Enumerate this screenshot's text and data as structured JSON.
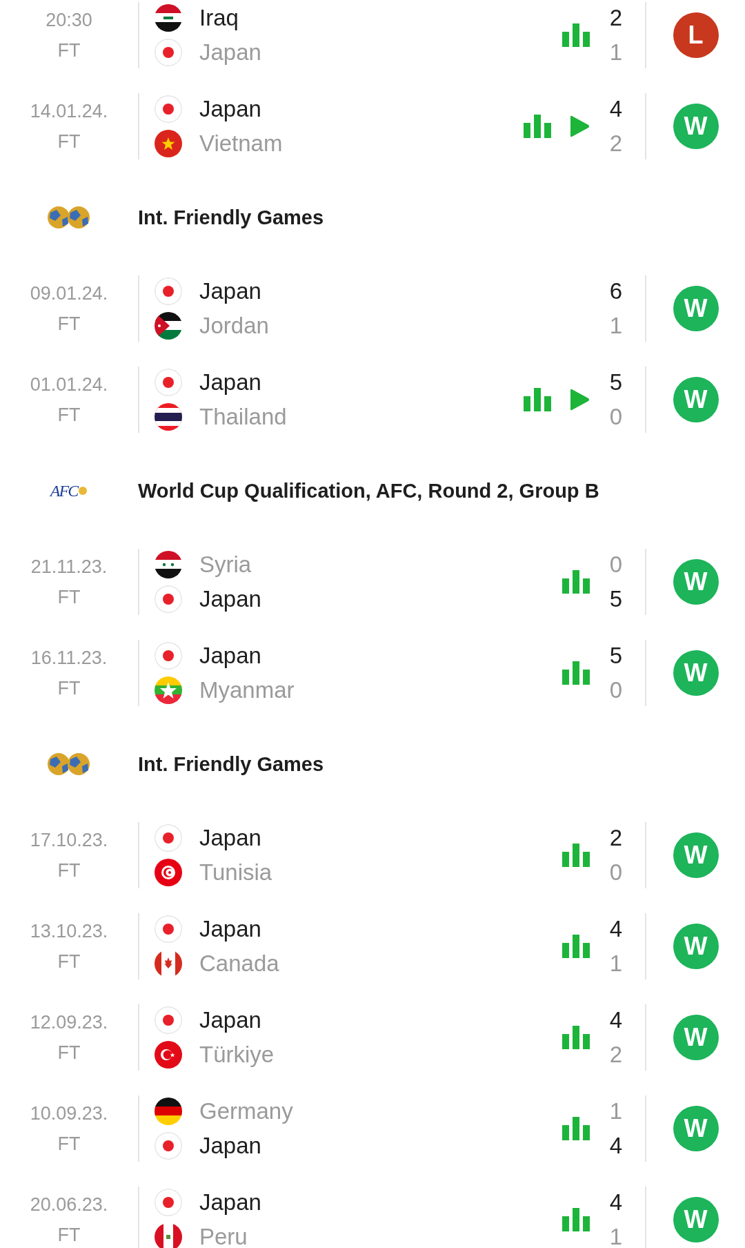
{
  "sections": [
    {
      "matches": [
        {
          "date": "20:30",
          "status": "FT",
          "home": {
            "name": "Iraq",
            "flag": {
              "kind": "iraq"
            },
            "score": "2",
            "winner": true
          },
          "away": {
            "name": "Japan",
            "flag": {
              "kind": "japan"
            },
            "score": "1",
            "winner": false
          },
          "stats": true,
          "video": false,
          "result": {
            "text": "L",
            "kind": "loss"
          }
        },
        {
          "date": "14.01.24.",
          "status": "FT",
          "home": {
            "name": "Japan",
            "flag": {
              "kind": "japan"
            },
            "score": "4",
            "winner": true
          },
          "away": {
            "name": "Vietnam",
            "flag": {
              "kind": "vietnam"
            },
            "score": "2",
            "winner": false
          },
          "stats": true,
          "video": true,
          "result": {
            "text": "W",
            "kind": "win"
          }
        }
      ]
    },
    {
      "competition": {
        "name": "Int. Friendly Games",
        "logo": {
          "kind": "balls"
        }
      },
      "matches": [
        {
          "date": "09.01.24.",
          "status": "FT",
          "home": {
            "name": "Japan",
            "flag": {
              "kind": "japan"
            },
            "score": "6",
            "winner": true
          },
          "away": {
            "name": "Jordan",
            "flag": {
              "kind": "jordan"
            },
            "score": "1",
            "winner": false
          },
          "stats": false,
          "video": false,
          "result": {
            "text": "W",
            "kind": "win"
          }
        },
        {
          "date": "01.01.24.",
          "status": "FT",
          "home": {
            "name": "Japan",
            "flag": {
              "kind": "japan"
            },
            "score": "5",
            "winner": true
          },
          "away": {
            "name": "Thailand",
            "flag": {
              "kind": "thailand"
            },
            "score": "0",
            "winner": false
          },
          "stats": true,
          "video": true,
          "result": {
            "text": "W",
            "kind": "win"
          }
        }
      ]
    },
    {
      "competition": {
        "name": "World Cup Qualification, AFC, Round 2, Group B",
        "logo": {
          "kind": "afc",
          "text": "AFC"
        }
      },
      "matches": [
        {
          "date": "21.11.23.",
          "status": "FT",
          "home": {
            "name": "Syria",
            "flag": {
              "kind": "syria"
            },
            "score": "0",
            "winner": false
          },
          "away": {
            "name": "Japan",
            "flag": {
              "kind": "japan"
            },
            "score": "5",
            "winner": true
          },
          "stats": true,
          "video": false,
          "result": {
            "text": "W",
            "kind": "win"
          }
        },
        {
          "date": "16.11.23.",
          "status": "FT",
          "home": {
            "name": "Japan",
            "flag": {
              "kind": "japan"
            },
            "score": "5",
            "winner": true
          },
          "away": {
            "name": "Myanmar",
            "flag": {
              "kind": "myanmar"
            },
            "score": "0",
            "winner": false
          },
          "stats": true,
          "video": false,
          "result": {
            "text": "W",
            "kind": "win"
          }
        }
      ]
    },
    {
      "competition": {
        "name": "Int. Friendly Games",
        "logo": {
          "kind": "balls"
        }
      },
      "matches": [
        {
          "date": "17.10.23.",
          "status": "FT",
          "home": {
            "name": "Japan",
            "flag": {
              "kind": "japan"
            },
            "score": "2",
            "winner": true
          },
          "away": {
            "name": "Tunisia",
            "flag": {
              "kind": "tunisia"
            },
            "score": "0",
            "winner": false
          },
          "stats": true,
          "video": false,
          "result": {
            "text": "W",
            "kind": "win"
          }
        },
        {
          "date": "13.10.23.",
          "status": "FT",
          "home": {
            "name": "Japan",
            "flag": {
              "kind": "japan"
            },
            "score": "4",
            "winner": true
          },
          "away": {
            "name": "Canada",
            "flag": {
              "kind": "canada"
            },
            "score": "1",
            "winner": false
          },
          "stats": true,
          "video": false,
          "result": {
            "text": "W",
            "kind": "win"
          }
        },
        {
          "date": "12.09.23.",
          "status": "FT",
          "home": {
            "name": "Japan",
            "flag": {
              "kind": "japan"
            },
            "score": "4",
            "winner": true
          },
          "away": {
            "name": "Türkiye",
            "flag": {
              "kind": "turkiye"
            },
            "score": "2",
            "winner": false
          },
          "stats": true,
          "video": false,
          "result": {
            "text": "W",
            "kind": "win"
          }
        },
        {
          "date": "10.09.23.",
          "status": "FT",
          "home": {
            "name": "Germany",
            "flag": {
              "kind": "germany"
            },
            "score": "1",
            "winner": false
          },
          "away": {
            "name": "Japan",
            "flag": {
              "kind": "japan"
            },
            "score": "4",
            "winner": true
          },
          "stats": true,
          "video": false,
          "result": {
            "text": "W",
            "kind": "win"
          }
        },
        {
          "date": "20.06.23.",
          "status": "FT",
          "home": {
            "name": "Japan",
            "flag": {
              "kind": "japan"
            },
            "score": "4",
            "winner": true
          },
          "away": {
            "name": "Peru",
            "flag": {
              "kind": "peru"
            },
            "score": "1",
            "winner": false
          },
          "stats": true,
          "video": false,
          "result": {
            "text": "W",
            "kind": "win"
          }
        }
      ]
    }
  ]
}
